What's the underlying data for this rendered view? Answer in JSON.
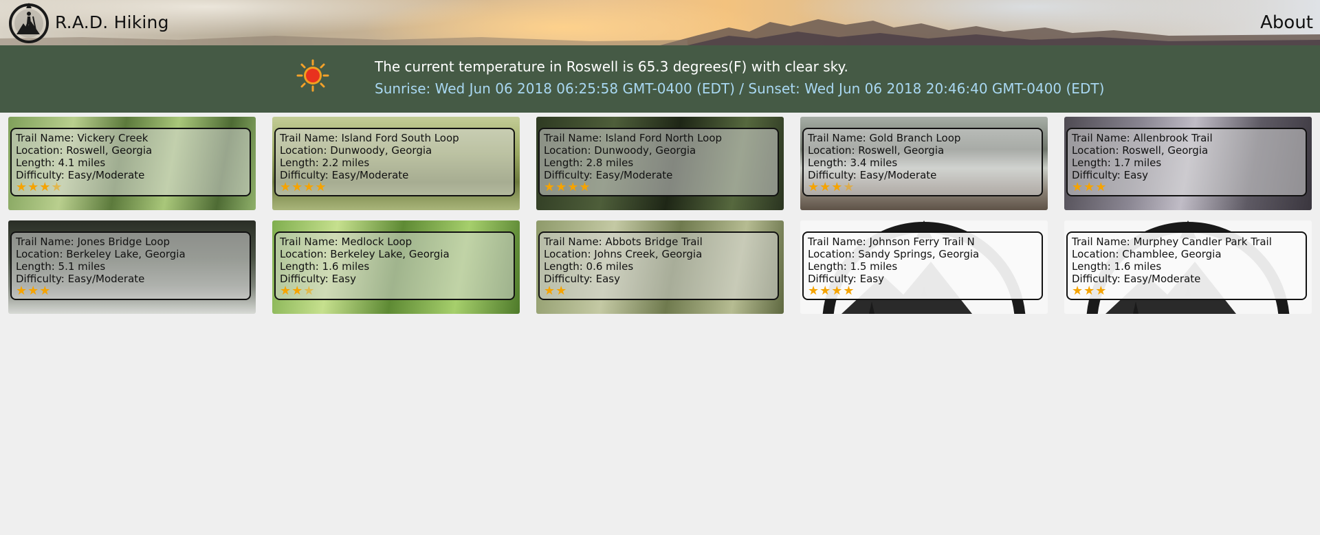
{
  "header": {
    "brand": "R.A.D. Hiking",
    "about_label": "About"
  },
  "weather": {
    "icon": "sun-icon",
    "current": "The current temperature in Roswell is 65.3 degrees(F) with clear sky.",
    "sun_times": "Sunrise: Wed Jun 06 2018 06:25:58 GMT-0400 (EDT) / Sunset: Wed Jun 06 2018 20:46:40 GMT-0400 (EDT)"
  },
  "colors": {
    "weather_band": "#455a45",
    "sun_times_text": "#a9d8f2",
    "star": "#f5a300",
    "page_background": "#efefef"
  },
  "trails": [
    {
      "name": "Trail Name: Vickery Creek",
      "location": "Location: Roswell, Georgia",
      "length": "Length: 4.1 miles",
      "difficulty": "Difficulty: Easy/Moderate",
      "rating": 3.5,
      "stars": "★★★",
      "half": "★",
      "image": "forest-photo"
    },
    {
      "name": "Trail Name: Island Ford South Loop",
      "location": "Location: Dunwoody, Georgia",
      "length": "Length: 2.2 miles",
      "difficulty": "Difficulty: Easy/Moderate",
      "rating": 4,
      "stars": "★★★★",
      "half": "",
      "image": "river-photo"
    },
    {
      "name": "Trail Name: Island Ford North Loop",
      "location": "Location: Dunwoody, Georgia",
      "length": "Length: 2.8 miles",
      "difficulty": "Difficulty: Easy/Moderate",
      "rating": 4,
      "stars": "★★★★",
      "half": "",
      "image": "dark-forest-photo"
    },
    {
      "name": "Trail Name: Gold Branch Loop",
      "location": "Location: Roswell, Georgia",
      "length": "Length: 3.4 miles",
      "difficulty": "Difficulty: Easy/Moderate",
      "rating": 3.5,
      "stars": "★★★",
      "half": "★",
      "image": "lake-photo"
    },
    {
      "name": "Trail Name: Allenbrook Trail",
      "location": "Location: Roswell, Georgia",
      "length": "Length: 1.7 miles",
      "difficulty": "Difficulty: Easy",
      "rating": 3,
      "stars": "★★★",
      "half": "",
      "image": "rock-photo"
    },
    {
      "name": "Trail Name: Jones Bridge Loop",
      "location": "Location: Berkeley Lake, Georgia",
      "length": "Length: 5.1 miles",
      "difficulty": "Difficulty: Easy/Moderate",
      "rating": 3,
      "stars": "★★★",
      "half": "",
      "image": "canopy-photo"
    },
    {
      "name": "Trail Name: Medlock Loop",
      "location": "Location: Berkeley Lake, Georgia",
      "length": "Length: 1.6 miles",
      "difficulty": "Difficulty: Easy",
      "rating": 2.5,
      "stars": "★★",
      "half": "★",
      "image": "green-forest-photo"
    },
    {
      "name": "Trail Name: Abbots Bridge Trail",
      "location": "Location: Johns Creek, Georgia",
      "length": "Length: 0.6 miles",
      "difficulty": "Difficulty: Easy",
      "rating": 2,
      "stars": "★★",
      "half": "",
      "image": "tree-photo"
    },
    {
      "name": "Trail Name: Johnson Ferry Trail N",
      "location": "Location: Sandy Springs, Georgia",
      "length": "Length: 1.5 miles",
      "difficulty": "Difficulty: Easy",
      "rating": 4,
      "stars": "★★★★",
      "half": "",
      "image": "compass-logo"
    },
    {
      "name": "Trail Name: Murphey Candler Park Trail",
      "location": "Location: Chamblee, Georgia",
      "length": "Length: 1.6 miles",
      "difficulty": "Difficulty: Easy/Moderate",
      "rating": 3,
      "stars": "★★★",
      "half": "",
      "image": "compass-logo"
    }
  ]
}
